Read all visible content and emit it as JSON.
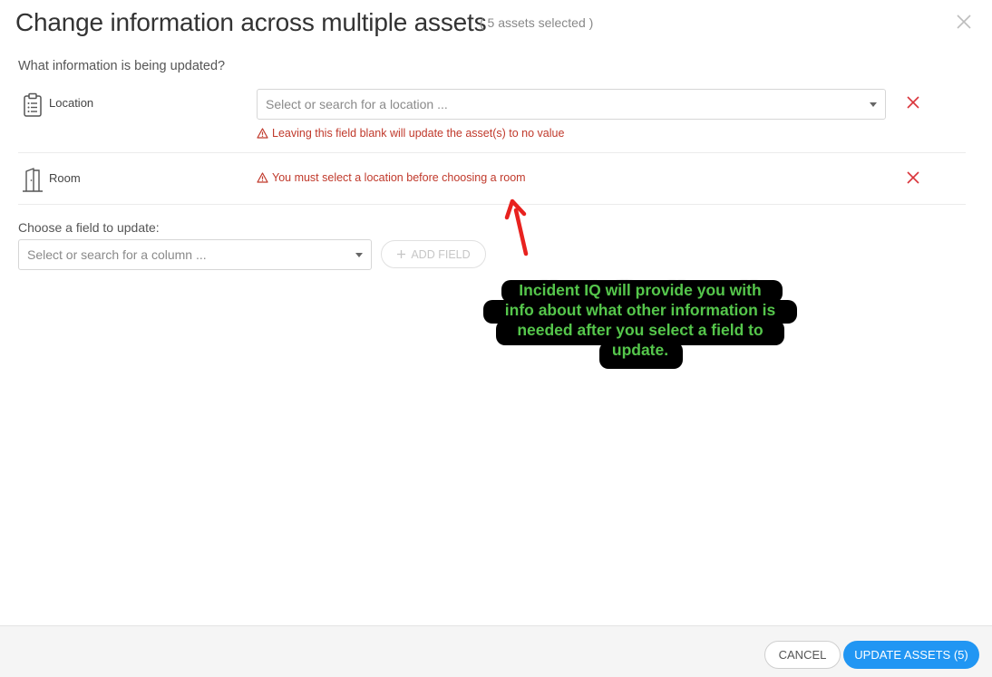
{
  "header": {
    "title": "Change information across multiple assets",
    "subtitle": "( 5 assets selected )"
  },
  "section_label": "What information is being updated?",
  "fields": [
    {
      "name": "Location",
      "icon": "clipboard-list-icon",
      "select_placeholder": "Select or search for a location ...",
      "warning": "Leaving this field blank will update the asset(s) to no value"
    },
    {
      "name": "Room",
      "icon": "door-icon",
      "warning": "You must select a location before choosing a room"
    }
  ],
  "chooser": {
    "label": "Choose a field to update:",
    "placeholder": "Select or search for a column ...",
    "add_label": "ADD FIELD"
  },
  "annotation": {
    "lines": [
      "Incident IQ will provide you with",
      "info about what other information is",
      "needed after you select a field to",
      "update."
    ],
    "text_color": "#55c64b",
    "arrow_color": "#e8221f"
  },
  "footer": {
    "cancel_label": "CANCEL",
    "update_label": "UPDATE ASSETS (5)",
    "accent": "#2196f3"
  },
  "colors": {
    "warning": "#c0392b",
    "remove_icon": "#d9343a"
  }
}
